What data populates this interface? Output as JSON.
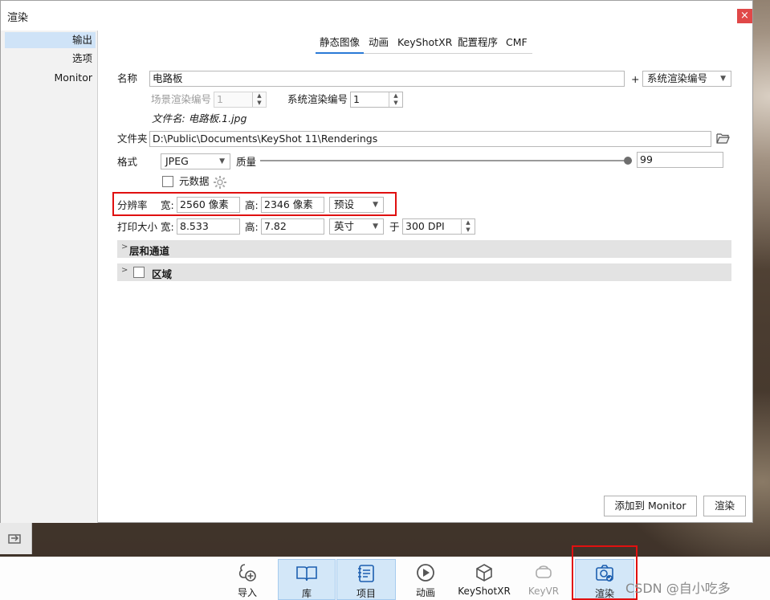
{
  "window": {
    "title": "渲染",
    "close_glyph": "×"
  },
  "sidebar": {
    "items": [
      {
        "label": "输出",
        "active": true
      },
      {
        "label": "选项",
        "active": false
      },
      {
        "label": "Monitor",
        "active": false
      }
    ]
  },
  "tabs": [
    {
      "label": "静态图像",
      "active": true
    },
    {
      "label": "动画",
      "active": false
    },
    {
      "label": "KeyShotXR",
      "active": false
    },
    {
      "label": "配置程序",
      "active": false
    },
    {
      "label": "CMF",
      "active": false
    }
  ],
  "name": {
    "label": "名称",
    "value": "电路板",
    "plus": "+",
    "suffix_select": "系统渲染编号",
    "scene_number_label": "场景渲染编号",
    "scene_number_value": "1",
    "system_number_label": "系统渲染编号",
    "system_number_value": "1",
    "filename_text": "文件名: 电路板.1.jpg"
  },
  "folder": {
    "label": "文件夹",
    "value": "D:\\Public\\Documents\\KeyShot 11\\Renderings",
    "icon": "folder-open-icon"
  },
  "format": {
    "label": "格式",
    "value": "JPEG",
    "quality_label": "质量",
    "quality_value": "99",
    "quality_fraction": 0.99,
    "metadata_label": "元数据",
    "metadata_checked": false
  },
  "resolution": {
    "label": "分辨率",
    "width_label": "宽:",
    "width_value": "2560 像素",
    "height_label": "高:",
    "height_value": "2346 像素",
    "preset": "预设"
  },
  "print_size": {
    "label": "打印大小",
    "width_label": "宽:",
    "width_value": "8.533",
    "height_label": "高:",
    "height_value": "7.82",
    "unit": "英寸",
    "at_label": "于",
    "dpi_value": "300 DPI"
  },
  "sections": [
    {
      "title": "层和通道",
      "has_checkbox": false,
      "checked": false
    },
    {
      "title": "区域",
      "has_checkbox": true,
      "checked": false
    }
  ],
  "buttons": {
    "add_to_monitor": "添加到 Monitor",
    "render": "渲染"
  },
  "toolbar": {
    "items": [
      {
        "label": "导入",
        "icon": "import-icon",
        "selected": false,
        "disabled": false
      },
      {
        "label": "库",
        "icon": "library-book-icon",
        "selected": true,
        "disabled": false
      },
      {
        "label": "项目",
        "icon": "project-icon",
        "selected": true,
        "disabled": false
      },
      {
        "label": "动画",
        "icon": "animation-play-icon",
        "selected": false,
        "disabled": false
      },
      {
        "label": "KeyShotXR",
        "icon": "keyshotxr-cube-icon",
        "selected": false,
        "disabled": false
      },
      {
        "label": "KeyVR",
        "icon": "keyvr-headset-icon",
        "selected": false,
        "disabled": true
      },
      {
        "label": "渲染",
        "icon": "render-camera-icon",
        "selected": true,
        "disabled": false
      }
    ]
  },
  "watermark": "CSDN @自小吃多",
  "colors": {
    "accent": "#2a7ad6",
    "highlight": "#e01010",
    "selected_bg": "#d3e7f8",
    "section_bg": "#e3e3e3"
  }
}
